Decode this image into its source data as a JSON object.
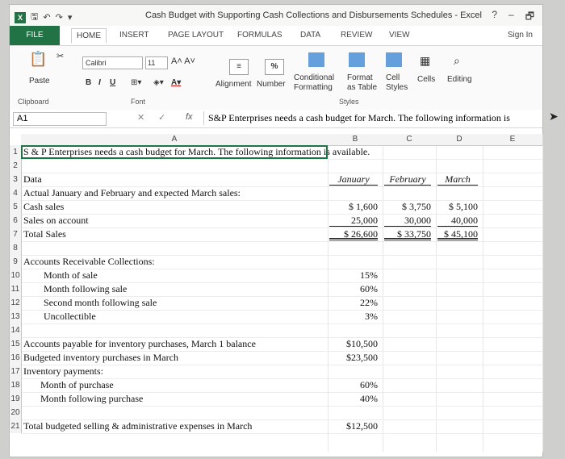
{
  "window": {
    "title": "Cash Budget with Supporting Cash Collections and Disbursements Schedules - Excel",
    "help": "?",
    "min": "–",
    "restore": "🗗"
  },
  "tabs": [
    {
      "label": "FILE"
    },
    {
      "label": "HOME"
    },
    {
      "label": "INSERT"
    },
    {
      "label": "PAGE LAYOUT"
    },
    {
      "label": "FORMULAS"
    },
    {
      "label": "DATA"
    },
    {
      "label": "REVIEW"
    },
    {
      "label": "VIEW"
    }
  ],
  "sign_in": "Sign In",
  "ribbon": {
    "paste": "Paste",
    "font_name": "Calibri",
    "font_size": "11",
    "bold": "B",
    "italic": "I",
    "underline": "U",
    "alignment": "Alignment",
    "number": "Number",
    "percent": "%",
    "conditional": "Conditional Formatting",
    "format_table": "Format as Table",
    "cell_styles": "Cell Styles",
    "cells": "Cells",
    "editing": "Editing",
    "groups": {
      "clipboard": "Clipboard",
      "font": "Font",
      "styles": "Styles"
    }
  },
  "formula_bar": {
    "name_box": "A1",
    "fx": "fx",
    "content": "S&P Enterprises needs a cash budget for March. The following information is"
  },
  "columns": [
    "A",
    "B",
    "C",
    "D",
    "E"
  ],
  "rows": [
    {
      "n": "1",
      "a": "S & P Enterprises needs a cash budget for March. The following information is available."
    },
    {
      "n": "2"
    },
    {
      "n": "3",
      "a": "Data",
      "b": "January",
      "c": "February",
      "d": "March"
    },
    {
      "n": "4",
      "a": "Actual January and February and expected March sales:"
    },
    {
      "n": "5",
      "a": "Cash sales",
      "b": "$      1,600",
      "c": "$      3,750",
      "d": "$      5,100"
    },
    {
      "n": "6",
      "a": "Sales on account",
      "b": "25,000",
      "c": "30,000",
      "d": "40,000"
    },
    {
      "n": "7",
      "a": "Total Sales",
      "b": "$   26,600",
      "c": "$   33,750",
      "d": "$   45,100"
    },
    {
      "n": "8"
    },
    {
      "n": "9",
      "a": "Accounts Receivable Collections:"
    },
    {
      "n": "10",
      "a": "Month of sale",
      "b": "15%"
    },
    {
      "n": "11",
      "a": "Month following sale",
      "b": "60%"
    },
    {
      "n": "12",
      "a": "Second month following sale",
      "b": "22%"
    },
    {
      "n": "13",
      "a": "Uncollectible",
      "b": "3%"
    },
    {
      "n": "14"
    },
    {
      "n": "15",
      "a": "Accounts payable for inventory purchases, March 1 balance",
      "b": "$10,500"
    },
    {
      "n": "16",
      "a": "Budgeted inventory purchases in March",
      "b": "$23,500"
    },
    {
      "n": "17",
      "a": "Inventory payments:"
    },
    {
      "n": "18",
      "a": "Month of purchase",
      "b": "60%"
    },
    {
      "n": "19",
      "a": "Month following purchase",
      "b": "40%"
    },
    {
      "n": "20"
    },
    {
      "n": "21",
      "a": "Total budgeted selling & administrative expenses in March",
      "b": "$12,500"
    }
  ]
}
